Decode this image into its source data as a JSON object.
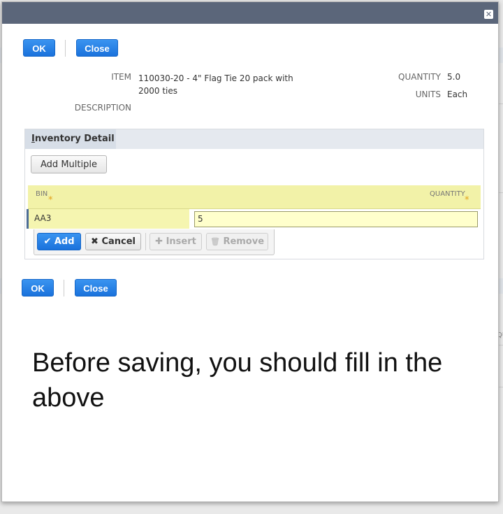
{
  "dialog": {
    "close_glyph": "✕"
  },
  "top_buttons": {
    "ok": "OK",
    "close": "Close"
  },
  "bottom_buttons": {
    "ok": "OK",
    "close": "Close"
  },
  "fields": {
    "item_label": "ITEM",
    "item_value": "110030-20 - 4\" Flag Tie 20 pack with 2000 ties",
    "description_label": "DESCRIPTION",
    "quantity_label": "QUANTITY",
    "quantity_value": "5.0",
    "units_label": "UNITS",
    "units_value": "Each"
  },
  "inventory_detail": {
    "tab_label_first": "I",
    "tab_label_rest": "nventory Detail",
    "add_multiple": "Add Multiple",
    "columns": {
      "bin": "BIN",
      "quantity": "QUANTITY"
    },
    "required_mark": "*",
    "row": {
      "bin": "AA3",
      "quantity": "5"
    },
    "toolbar": {
      "add": "Add",
      "cancel": "Cancel",
      "insert": "Insert",
      "remove": "Remove",
      "add_icon": "✔",
      "cancel_icon": "✖",
      "insert_icon": "✚",
      "remove_icon": "🗑"
    }
  },
  "background": {
    "fragment_text": "QU"
  },
  "annotation": "Before saving, you should fill in the above",
  "colors": {
    "header": "#5b667a",
    "accent": "#1a72dc",
    "grid_highlight": "#f2f2a8"
  }
}
